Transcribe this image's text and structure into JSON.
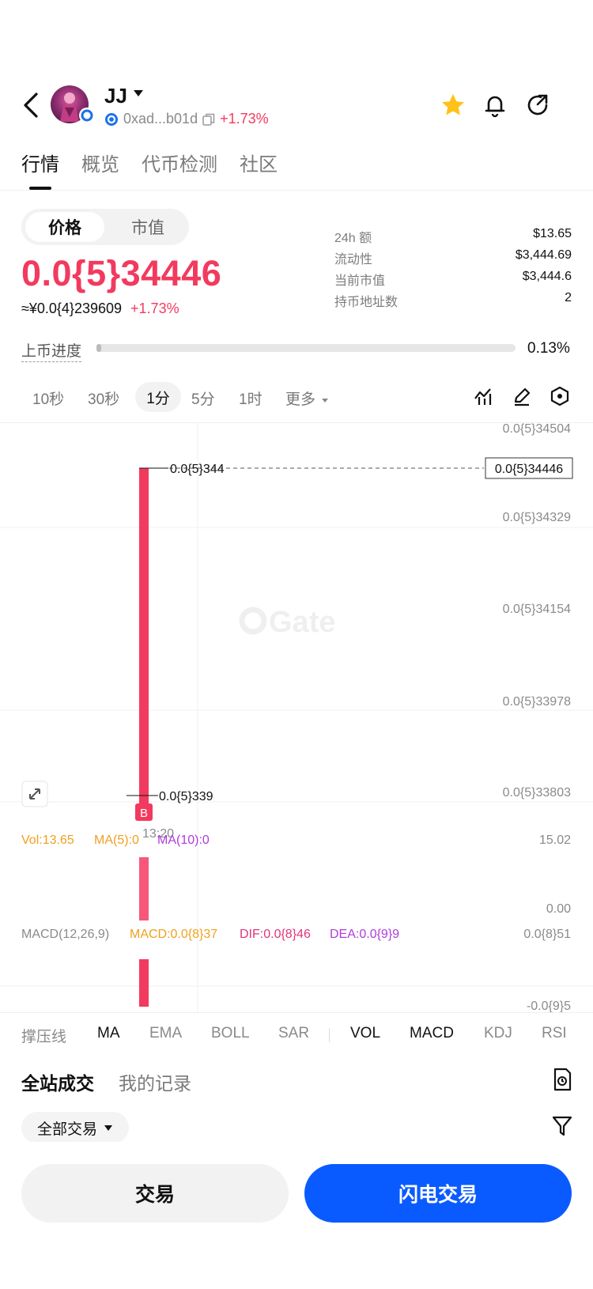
{
  "header": {
    "token_name": "JJ",
    "address": "0xad...b01d",
    "change": "+1.73%",
    "icons": [
      "back-icon",
      "chevron-down-icon",
      "copy-icon",
      "star-icon",
      "bell-icon",
      "share-icon"
    ]
  },
  "tabs": [
    {
      "label": "行情",
      "active": true
    },
    {
      "label": "概览",
      "active": false
    },
    {
      "label": "代币检测",
      "active": false
    },
    {
      "label": "社区",
      "active": false
    }
  ],
  "price": {
    "toggle_price": "价格",
    "toggle_mcap": "市值",
    "value": "0.0{5}34446",
    "cny": "≈¥0.0{4}239609",
    "change": "+1.73%"
  },
  "stats": [
    {
      "label": "24h  额",
      "value": "$13.65"
    },
    {
      "label": "流动性",
      "value": "$3,444.69"
    },
    {
      "label": "当前市值",
      "value": "$3,444.6"
    },
    {
      "label": "持币地址数",
      "value": "2"
    }
  ],
  "progress": {
    "label": "上币进度",
    "value": "0.13%",
    "fraction": 0.0013
  },
  "timeframes": [
    "10秒",
    "30秒",
    "1分",
    "5分",
    "1时",
    "更多"
  ],
  "active_timeframe": "1分",
  "chart": {
    "y_labels": [
      "0.0{5}34504",
      "0.0{5}34329",
      "0.0{5}34154",
      "0.0{5}33978",
      "0.0{5}33803"
    ],
    "current_price_tag": "0.0{5}34446",
    "high_label": "0.0{5}344",
    "low_label": "0.0{5}339",
    "time_label": "13:20",
    "buy_marker": "B",
    "watermark": "Gate",
    "vol": {
      "vol": "Vol:13.65",
      "ma5": "MA(5):0",
      "ma10": "MA(10):0",
      "max": "15.02",
      "min": "0.00"
    },
    "macd": {
      "name": "MACD(12,26,9)",
      "macd": "MACD:0.0{8}37",
      "dif": "DIF:0.0{8}46",
      "dea": "DEA:0.0{9}9",
      "max": "0.0{8}51",
      "min": "-0.0{9}5"
    },
    "colors": {
      "up": "#f23a5f",
      "vol_bar": "#f7577a",
      "ma5": "#f0a020",
      "ma10": "#b03cdc",
      "dif": "#e0357a",
      "dea": "#b03cdc"
    }
  },
  "indicators": {
    "main": [
      "撑压线",
      "MA",
      "EMA",
      "BOLL",
      "SAR"
    ],
    "sub": [
      "VOL",
      "MACD",
      "KDJ",
      "RSI"
    ],
    "active": [
      "MA",
      "VOL",
      "MACD"
    ]
  },
  "trades": {
    "tab_all": "全站成交",
    "tab_mine": "我的记录",
    "filter": "全部交易"
  },
  "actions": {
    "trade": "交易",
    "flash_trade": "闪电交易"
  }
}
